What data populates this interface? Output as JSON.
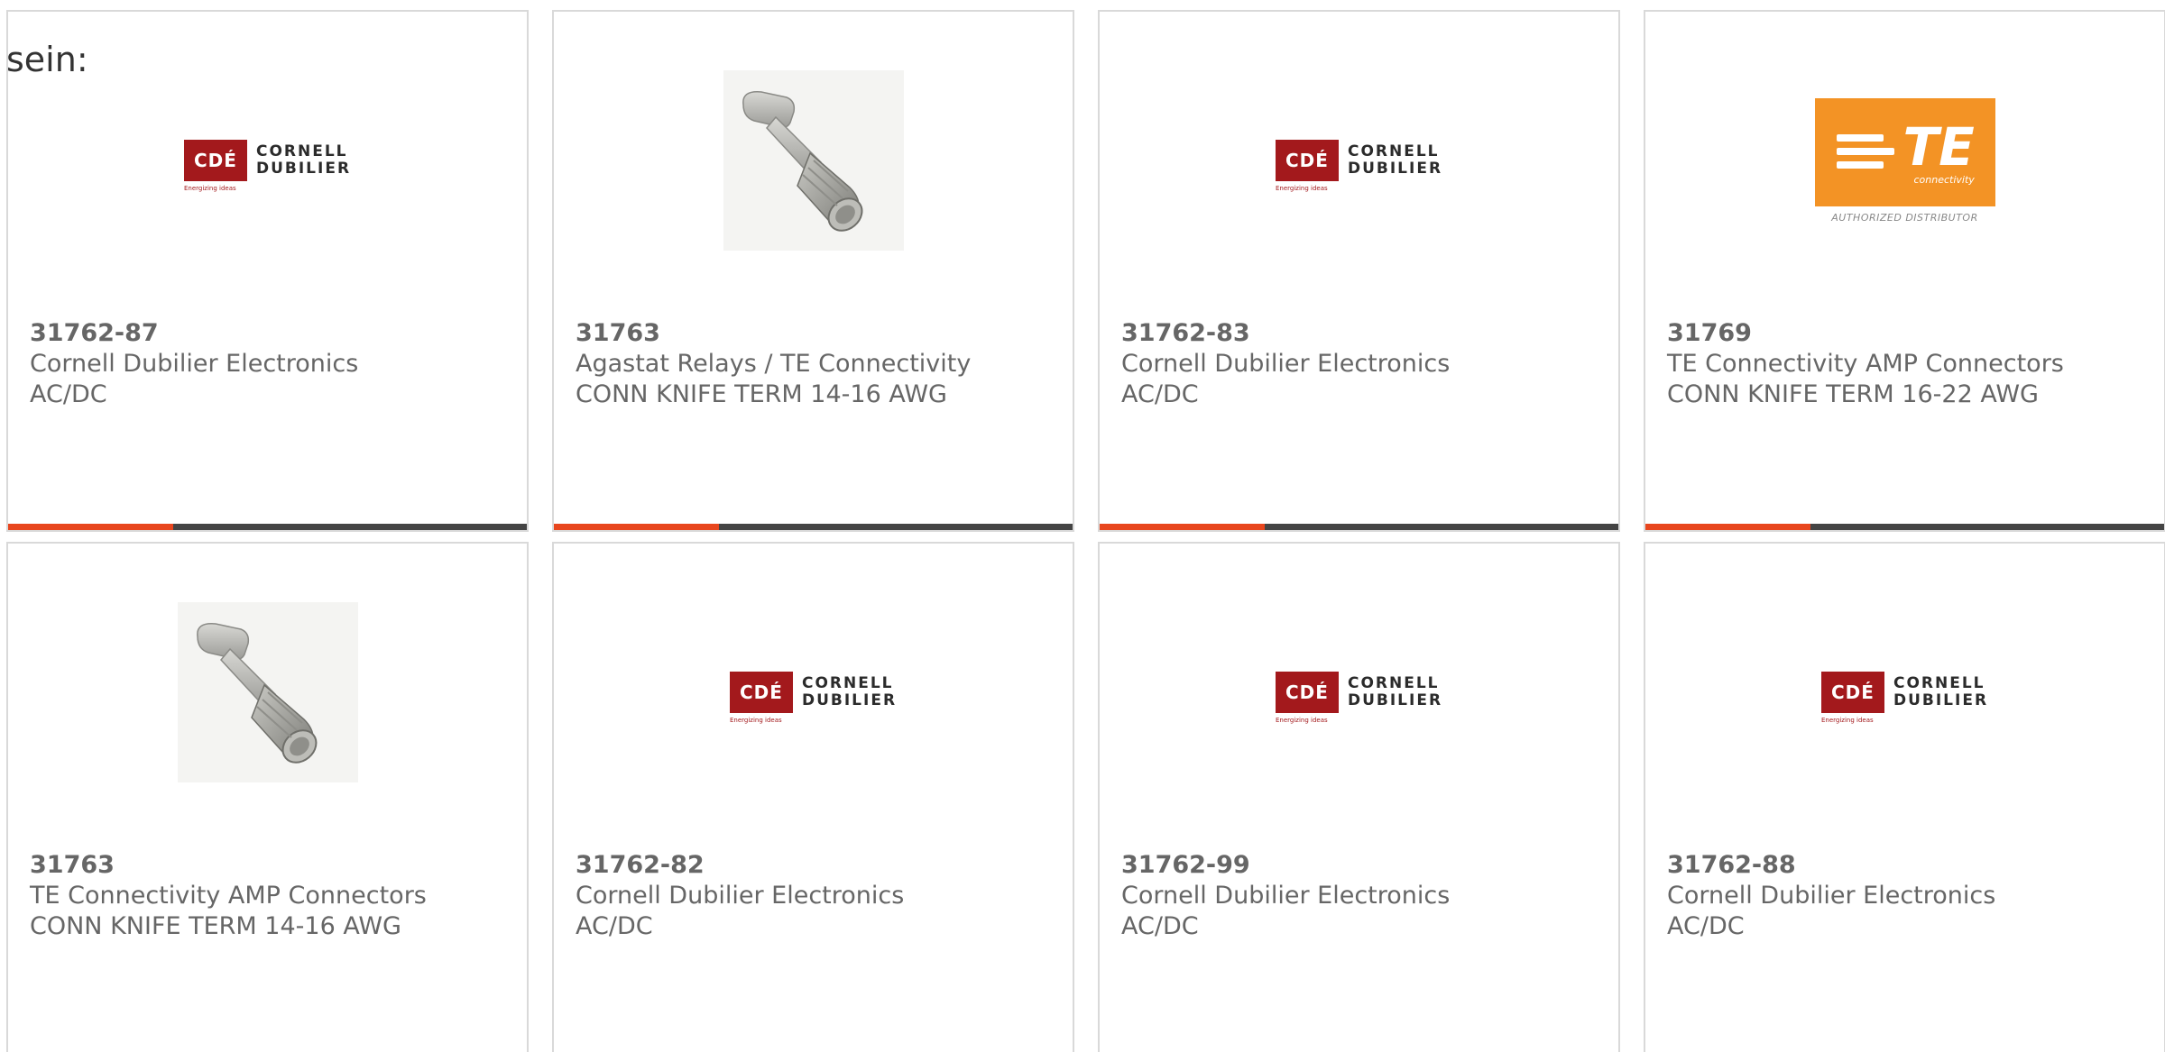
{
  "intro_text": "sein:",
  "products": [
    {
      "part_number": "31762-87",
      "manufacturer": "Cornell Dubilier Electronics",
      "description": "AC/DC",
      "image": "cde-logo",
      "logo_words": [
        "CORNELL",
        "DUBILIER"
      ],
      "logo_mark": "CDÉ",
      "logo_tag": "Energizing ideas"
    },
    {
      "part_number": "31763",
      "manufacturer": "Agastat Relays / TE Connectivity",
      "description": "CONN KNIFE TERM 14-16 AWG",
      "image": "knife-terminal"
    },
    {
      "part_number": "31762-83",
      "manufacturer": "Cornell Dubilier Electronics",
      "description": "AC/DC",
      "image": "cde-logo",
      "logo_words": [
        "CORNELL",
        "DUBILIER"
      ],
      "logo_mark": "CDÉ",
      "logo_tag": "Energizing ideas"
    },
    {
      "part_number": "31769",
      "manufacturer": "TE Connectivity AMP Connectors",
      "description": "CONN KNIFE TERM 16-22 AWG",
      "image": "te-logo",
      "logo_text": "TE",
      "logo_sub": "connectivity",
      "logo_caption": "AUTHORIZED DISTRIBUTOR"
    },
    {
      "part_number": "31763",
      "manufacturer": "TE Connectivity AMP Connectors",
      "description": "CONN KNIFE TERM 14-16 AWG",
      "image": "knife-terminal"
    },
    {
      "part_number": "31762-82",
      "manufacturer": "Cornell Dubilier Electronics",
      "description": "AC/DC",
      "image": "cde-logo",
      "logo_words": [
        "CORNELL",
        "DUBILIER"
      ],
      "logo_mark": "CDÉ",
      "logo_tag": "Energizing ideas"
    },
    {
      "part_number": "31762-99",
      "manufacturer": "Cornell Dubilier Electronics",
      "description": "AC/DC",
      "image": "cde-logo",
      "logo_words": [
        "CORNELL",
        "DUBILIER"
      ],
      "logo_mark": "CDÉ",
      "logo_tag": "Energizing ideas"
    },
    {
      "part_number": "31762-88",
      "manufacturer": "Cornell Dubilier Electronics",
      "description": "AC/DC",
      "image": "cde-logo",
      "logo_words": [
        "CORNELL",
        "DUBILIER"
      ],
      "logo_mark": "CDÉ",
      "logo_tag": "Energizing ideas"
    }
  ],
  "colors": {
    "accent": "#e8461e",
    "bar": "#444444",
    "text": "#666666",
    "cde_red": "#a3191c",
    "te_orange": "#f39325"
  }
}
